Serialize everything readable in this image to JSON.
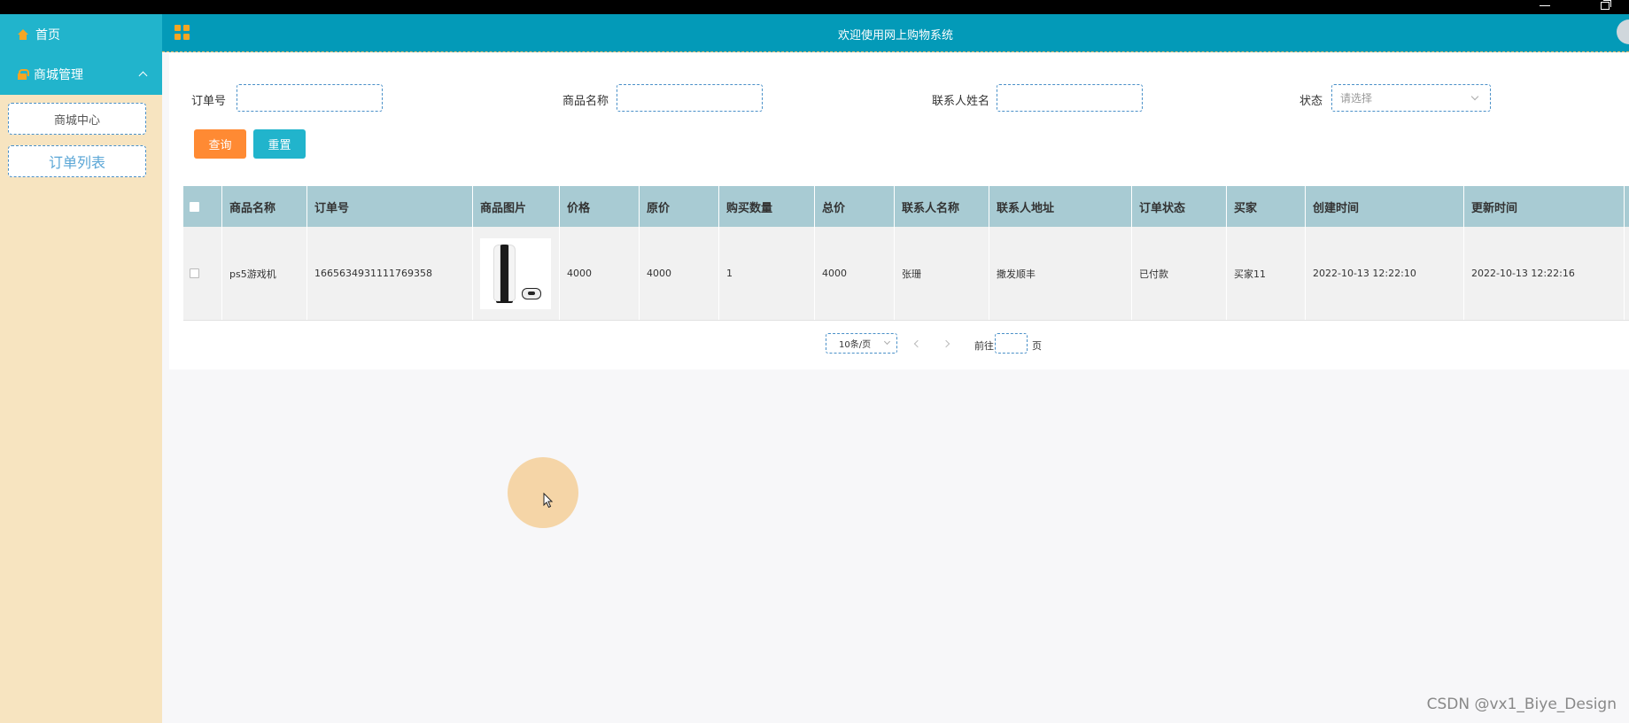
{
  "header": {
    "title": "欢迎使用网上购物系统"
  },
  "sidebar": {
    "home_label": "首页",
    "mall_label": "商城管理",
    "sub_items": [
      {
        "label": "商城中心"
      },
      {
        "label": "订单列表"
      }
    ]
  },
  "filters": {
    "order_no_label": "订单号",
    "order_no_value": "",
    "product_name_label": "商品名称",
    "product_name_value": "",
    "contact_name_label": "联系人姓名",
    "contact_name_value": "",
    "status_label": "状态",
    "status_placeholder": "请选择"
  },
  "buttons": {
    "query": "查询",
    "reset": "重置"
  },
  "table": {
    "columns": [
      "商品名称",
      "订单号",
      "商品图片",
      "价格",
      "原价",
      "购买数量",
      "总价",
      "联系人名称",
      "联系人地址",
      "订单状态",
      "买家",
      "创建时间",
      "更新时间"
    ],
    "rows": [
      {
        "product_name": "ps5游戏机",
        "order_no": "1665634931111769358",
        "image": "ps5-console-image",
        "price": "4000",
        "original_price": "4000",
        "quantity": "1",
        "total": "4000",
        "contact_name": "张珊",
        "contact_address": "撒发顺丰",
        "status": "已付款",
        "buyer": "买家11",
        "created": "2022-10-13 12:22:10",
        "updated": "2022-10-13 12:22:16"
      }
    ]
  },
  "pagination": {
    "page_size": "10条/页",
    "goto_label": "前往",
    "goto_value": "",
    "page_unit": "页"
  },
  "watermark": "CSDN @vx1_Biye_Design",
  "colors": {
    "sidebar_top": "#21b4cc",
    "sidebar_bg": "#f7e4c0",
    "header": "#039ab8",
    "accent_orange": "#ff8a33",
    "table_header": "#a8cbd3"
  }
}
